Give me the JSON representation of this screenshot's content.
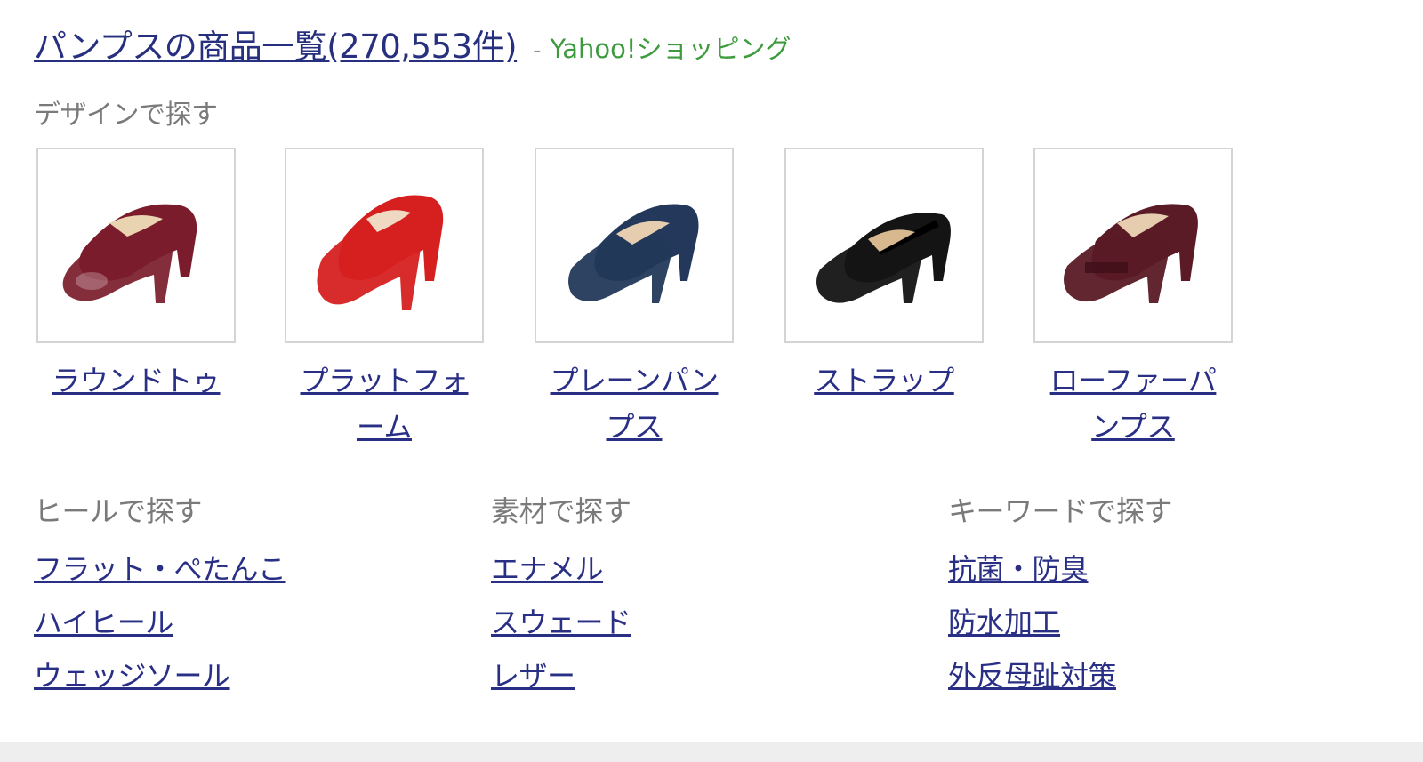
{
  "result": {
    "title": "パンプスの商品一覧(270,553件)",
    "separator": "-",
    "source": "Yahoo!ショッピング"
  },
  "design": {
    "heading": "デザインで探す",
    "items": [
      {
        "label": "ラウンドトゥ",
        "shoe_color": "#7a1c2b",
        "accent": "#9b2b3a"
      },
      {
        "label": "プラットフォーム",
        "shoe_color": "#d62020",
        "accent": "#ee3a2c"
      },
      {
        "label": "プレーンパンプス",
        "shoe_color": "#23385a",
        "accent": "#34507e"
      },
      {
        "label": "ストラップ",
        "shoe_color": "#141414",
        "accent": "#2b2b2b"
      },
      {
        "label": "ローファーパンプス",
        "shoe_color": "#5a1a26",
        "accent": "#7a2838"
      }
    ]
  },
  "heel": {
    "heading": "ヒールで探す",
    "links": [
      "フラット・ぺたんこ",
      "ハイヒール",
      "ウェッジソール"
    ]
  },
  "material": {
    "heading": "素材で探す",
    "links": [
      "エナメル",
      "スウェード",
      "レザー"
    ]
  },
  "keyword": {
    "heading": "キーワードで探す",
    "links": [
      "抗菌・防臭",
      "防水加工",
      "外反母趾対策"
    ]
  }
}
